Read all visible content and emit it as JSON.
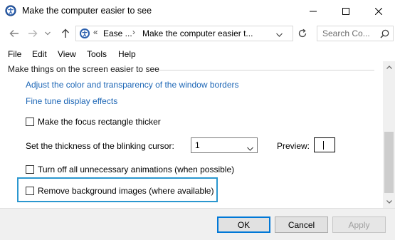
{
  "window": {
    "title": "Make the computer easier to see",
    "icon": "ease-of-access-icon",
    "controls": [
      "minimize-icon",
      "maximize-icon",
      "close-icon"
    ]
  },
  "navigation": {
    "back_icon": "back-arrow-icon",
    "forward_icon": "forward-arrow-icon",
    "recent_icon": "chevron-down-icon",
    "up_icon": "up-arrow-icon",
    "breadcrumb": {
      "overflow": "«",
      "items": [
        "Ease ...",
        "Make the computer easier t..."
      ],
      "separator": "›"
    },
    "refresh_icon": "refresh-icon",
    "search_placeholder": "Search Co..."
  },
  "menu": {
    "items": [
      "File",
      "Edit",
      "View",
      "Tools",
      "Help"
    ]
  },
  "content": {
    "section_header": "Make things on the screen easier to see",
    "links": [
      "Adjust the color and transparency of the window borders",
      "Fine tune display effects"
    ],
    "focus_rectangle": {
      "label": "Make the focus rectangle thicker",
      "checked": false
    },
    "cursor_thickness": {
      "label": "Set the thickness of the blinking cursor:",
      "value": "1",
      "preview_label": "Preview:"
    },
    "animations": {
      "label": "Turn off all unnecessary animations (when possible)",
      "checked": false
    },
    "background_images": {
      "label": "Remove background images (where available)",
      "checked": false
    }
  },
  "footer": {
    "ok": "OK",
    "cancel": "Cancel",
    "apply": "Apply"
  },
  "colors": {
    "link": "#1e67b6",
    "highlight": "#2b97cf",
    "default_button_border": "#0078d7"
  }
}
